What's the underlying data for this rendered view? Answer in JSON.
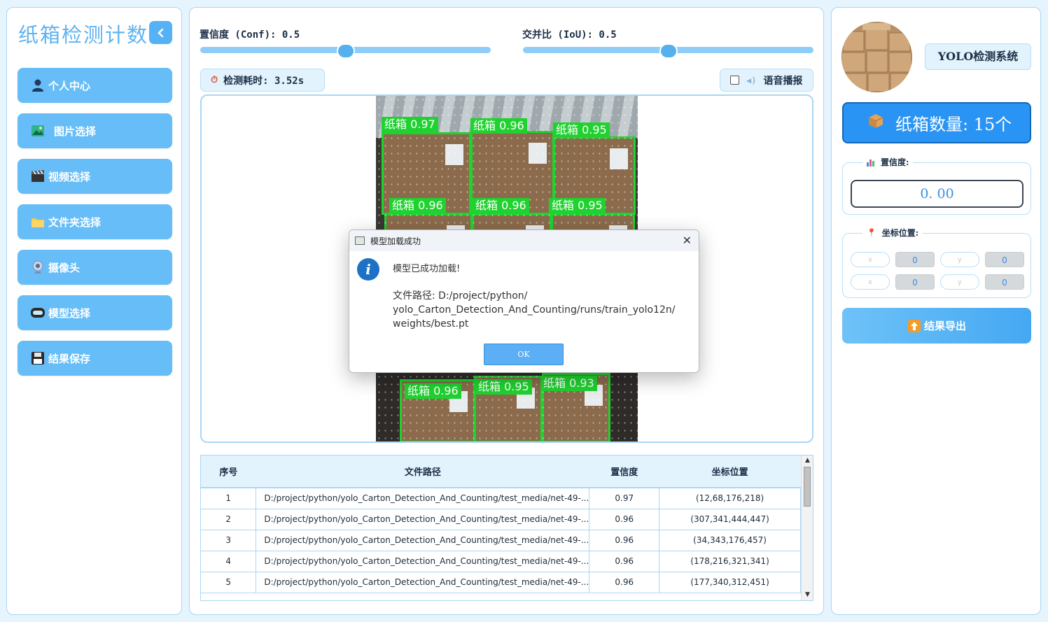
{
  "sidebar": {
    "title": "纸箱检测计数",
    "items": [
      {
        "label": "个人中心",
        "icon": "person-icon"
      },
      {
        "label": "图片选择",
        "icon": "image-icon"
      },
      {
        "label": "视频选择",
        "icon": "clapperboard-icon"
      },
      {
        "label": "文件夹选择",
        "icon": "folder-icon"
      },
      {
        "label": "摄像头",
        "icon": "webcam-icon"
      },
      {
        "label": "模型选择",
        "icon": "model-icon"
      },
      {
        "label": "结果保存",
        "icon": "floppy-icon"
      }
    ]
  },
  "controls": {
    "conf_label": "置信度 (Conf): 0.5",
    "conf_value": 0.5,
    "iou_label": "交并比 (IoU): 0.5",
    "iou_value": 0.5,
    "time_label": "检测耗时: 3.52s",
    "voice_label": "语音播报",
    "voice_checked": false
  },
  "detections": [
    {
      "label": "纸箱 0.97"
    },
    {
      "label": "纸箱 0.96"
    },
    {
      "label": "纸箱 0.95"
    },
    {
      "label": "纸箱 0.96"
    },
    {
      "label": "纸箱 0.96"
    },
    {
      "label": "纸箱 0.95"
    },
    {
      "label": "纸箱 0.96"
    },
    {
      "label": "纸箱 0.95"
    },
    {
      "label": "纸箱 0.93"
    }
  ],
  "table": {
    "headers": [
      "序号",
      "文件路径",
      "置信度",
      "坐标位置"
    ],
    "rows": [
      [
        "1",
        "D:/project/python/yolo_Carton_Detection_And_Counting/test_media/net-49-...",
        "0.97",
        "(12,68,176,218)"
      ],
      [
        "2",
        "D:/project/python/yolo_Carton_Detection_And_Counting/test_media/net-49-...",
        "0.96",
        "(307,341,444,447)"
      ],
      [
        "3",
        "D:/project/python/yolo_Carton_Detection_And_Counting/test_media/net-49-...",
        "0.96",
        "(34,343,176,457)"
      ],
      [
        "4",
        "D:/project/python/yolo_Carton_Detection_And_Counting/test_media/net-49-...",
        "0.96",
        "(178,216,321,341)"
      ],
      [
        "5",
        "D:/project/python/yolo_Carton_Detection_And_Counting/test_media/net-49-...",
        "0.96",
        "(177,340,312,451)"
      ]
    ]
  },
  "dialog": {
    "title": "模型加载成功",
    "message": "模型已成功加载!",
    "path_line1": "文件路径: D:/project/python/",
    "path_line2": "yolo_Carton_Detection_And_Counting/runs/train_yolo12n/",
    "path_line3": "weights/best.pt",
    "ok_label": "OK"
  },
  "right": {
    "system_badge": "YOLO检测系统",
    "count_label": "纸箱数量: 15个",
    "conf_group_title": "置信度:",
    "conf_value": "0. 00",
    "coord_group_title": "坐标位置:",
    "coords": [
      {
        "label": "x",
        "value": "0"
      },
      {
        "label": "y",
        "value": "0"
      },
      {
        "label": "x",
        "value": "0"
      },
      {
        "label": "y",
        "value": "0"
      }
    ],
    "export_label": "结果导出"
  },
  "colors": {
    "accent": "#66bdf7",
    "count_bg": "#2a94f4",
    "detection_box": "#1fd22f"
  }
}
